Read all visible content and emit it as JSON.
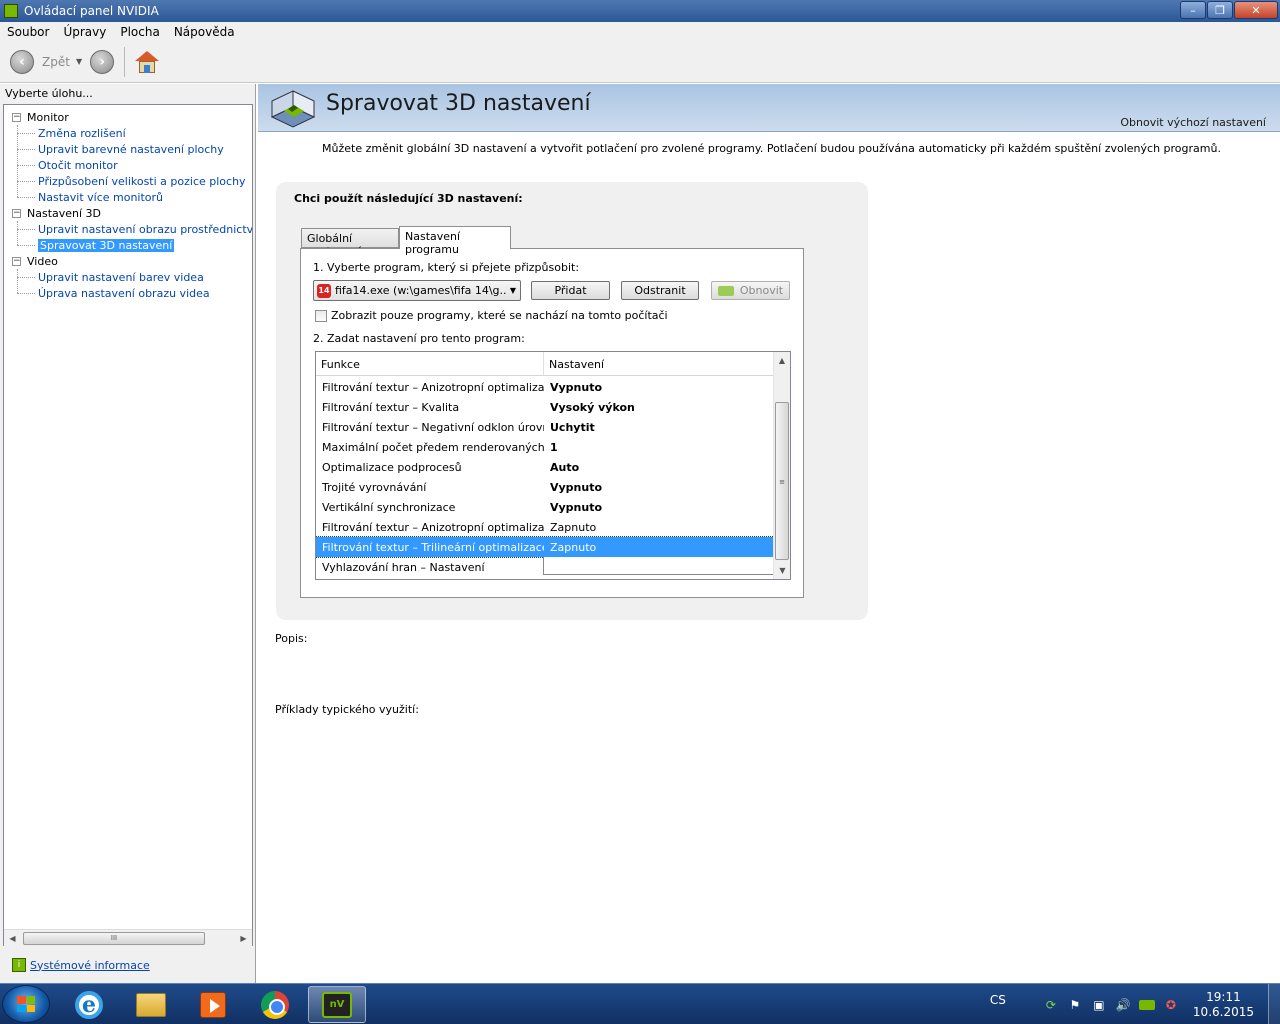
{
  "window": {
    "title": "Ovládací panel NVIDIA"
  },
  "menu": [
    "Soubor",
    "Úpravy",
    "Plocha",
    "Nápověda"
  ],
  "toolbar": {
    "back_label": "Zpět"
  },
  "left": {
    "header": "Vyberte úlohu...",
    "tree": [
      {
        "label": "Monitor",
        "children": [
          "Změna rozlišení",
          "Upravit barevné nastavení plochy",
          "Otočit monitor",
          "Přizpůsobení velikosti a pozice plochy",
          "Nastavit více monitorů"
        ]
      },
      {
        "label": "Nastavení 3D",
        "children": [
          "Upravit nastavení obrazu prostřednictvím n",
          "Spravovat 3D nastavení"
        ]
      },
      {
        "label": "Video",
        "children": [
          "Upravit nastavení barev videa",
          "Úprava nastavení obrazu videa"
        ]
      }
    ],
    "selected": "Spravovat 3D nastavení",
    "sysinfo": "Systémové informace"
  },
  "page": {
    "title": "Spravovat 3D nastavení",
    "restore_link": "Obnovit výchozí nastavení",
    "intro": "Můžete změnit globální 3D nastavení a vytvořit potlačení pro zvolené programy. Potlačení budou používána automaticky při každém spuštění zvolených programů.",
    "heading": "Chci použít následující 3D nastavení:",
    "tabs": [
      "Globální nastavení",
      "Nastavení programu"
    ],
    "step1": "1. Vyberte program, který si přejete přizpůsobit:",
    "program_icon": "14",
    "program_value": "fifa14.exe (w:\\games\\fifa 14\\g...",
    "btn_add": "Přidat",
    "btn_remove": "Odstranit",
    "btn_refresh": "Obnovit",
    "checkbox_label": "Zobrazit pouze programy, které se nachází na tomto počítači",
    "step2": "2. Zadat nastavení pro tento program:",
    "columns": [
      "Funkce",
      "Nastavení"
    ],
    "rows": [
      {
        "f": "Filtrování textur – Anizotropní optimalizac...",
        "v": "Vypnuto",
        "bold": true
      },
      {
        "f": "Filtrování textur – Kvalita",
        "v": "Vysoký výkon",
        "bold": true
      },
      {
        "f": "Filtrování textur – Negativní odklon úrovn...",
        "v": "Uchytit",
        "bold": true
      },
      {
        "f": "Maximální počet předem renderovaných s...",
        "v": "1",
        "bold": true
      },
      {
        "f": "Optimalizace podprocesů",
        "v": "Auto",
        "bold": true
      },
      {
        "f": "Trojité vyrovnávání",
        "v": "Vypnuto",
        "bold": true
      },
      {
        "f": "Vertikální synchronizace",
        "v": "Vypnuto",
        "bold": true
      },
      {
        "f": "Filtrování textur – Anizotropní optimalizac...",
        "v": "Zapnuto",
        "bold": false
      },
      {
        "f": "Filtrování textur – Trilineární optimalizace",
        "v": "Zapnuto",
        "bold": false,
        "selected": true
      },
      {
        "f": "Vyhlazování hran – Nastavení",
        "v": "",
        "bold": false
      }
    ],
    "desc_label": "Popis:",
    "usage_label": "Příklady typického využití:"
  },
  "taskbar": {
    "lang": "CS",
    "time": "19:11",
    "date": "10.6.2015",
    "nv_label": "nV"
  }
}
